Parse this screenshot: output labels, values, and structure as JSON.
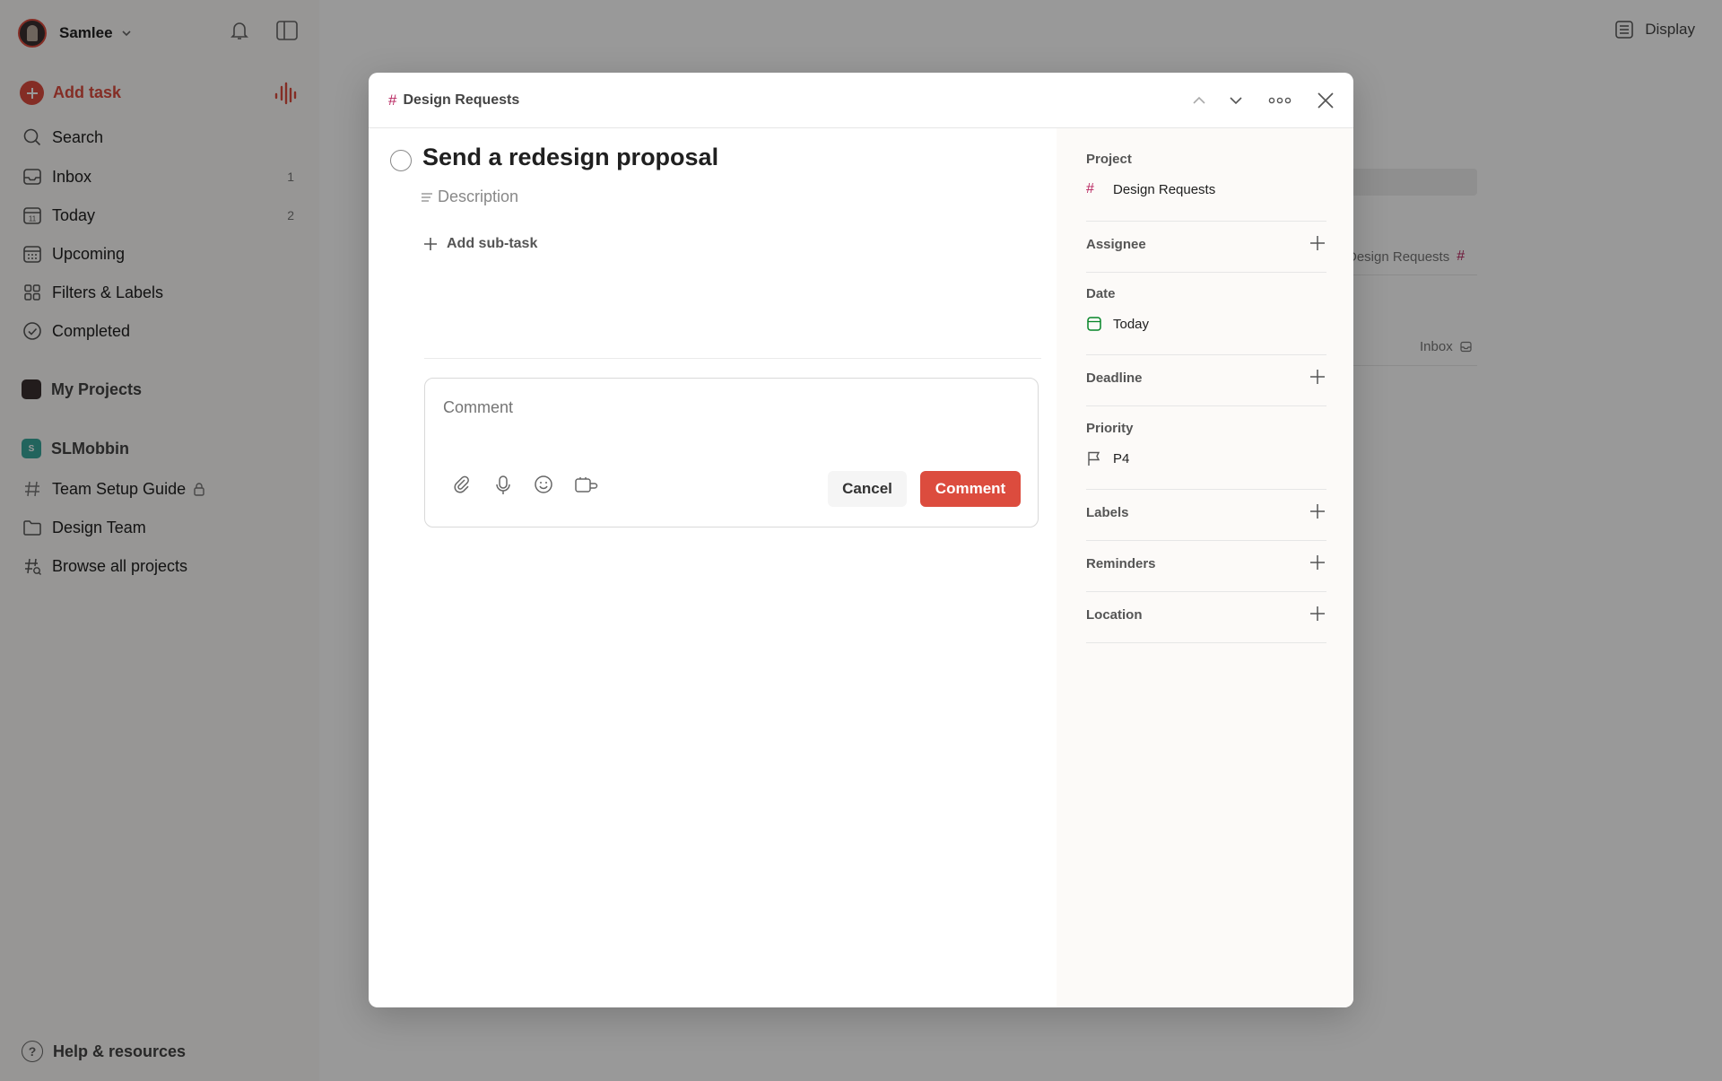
{
  "sidebar": {
    "user": {
      "name": "Samlee"
    },
    "add_task": {
      "label": "Add task"
    },
    "nav": [
      {
        "label": "Search",
        "count": "",
        "icon": "search-icon"
      },
      {
        "label": "Inbox",
        "count": "1",
        "icon": "inbox-icon"
      },
      {
        "label": "Today",
        "count": "2",
        "icon": "calendar-today-icon"
      },
      {
        "label": "Upcoming",
        "count": "",
        "icon": "calendar-grid-icon"
      },
      {
        "label": "Filters & Labels",
        "count": "",
        "icon": "grid-icon"
      },
      {
        "label": "Completed",
        "count": "",
        "icon": "check-circle-icon"
      }
    ],
    "my_projects": {
      "label": "My Projects"
    },
    "workspace": {
      "label": "SLMobbin",
      "badge": "S"
    },
    "projects": [
      {
        "label": "Team Setup Guide",
        "icon": "hash-icon"
      },
      {
        "label": "Design Team",
        "icon": "folder-icon"
      },
      {
        "label": "Browse all projects",
        "icon": "browse-projects-icon"
      }
    ],
    "help": {
      "label": "Help & resources"
    }
  },
  "main": {
    "display_label": "Display",
    "bg_rows": [
      {
        "label": "Design Requests"
      },
      {
        "label": "Inbox"
      }
    ]
  },
  "modal": {
    "breadcrumb": "Design Requests",
    "task": {
      "title": "Send a redesign proposal",
      "description_placeholder": "Description",
      "add_subtask_label": "Add sub-task"
    },
    "comment": {
      "placeholder": "Comment",
      "cancel_label": "Cancel",
      "submit_label": "Comment"
    },
    "properties": {
      "project": {
        "label": "Project",
        "value": "Design Requests"
      },
      "assignee": {
        "label": "Assignee"
      },
      "date": {
        "label": "Date",
        "value": "Today"
      },
      "deadline": {
        "label": "Deadline"
      },
      "priority": {
        "label": "Priority",
        "value": "P4"
      },
      "labels": {
        "label": "Labels"
      },
      "reminders": {
        "label": "Reminders"
      },
      "location": {
        "label": "Location"
      }
    }
  },
  "colors": {
    "accent": "#dc4c3e",
    "project_hash": "#b8255f",
    "today_green": "#058527",
    "workspace_badge": "#3aa79b"
  }
}
